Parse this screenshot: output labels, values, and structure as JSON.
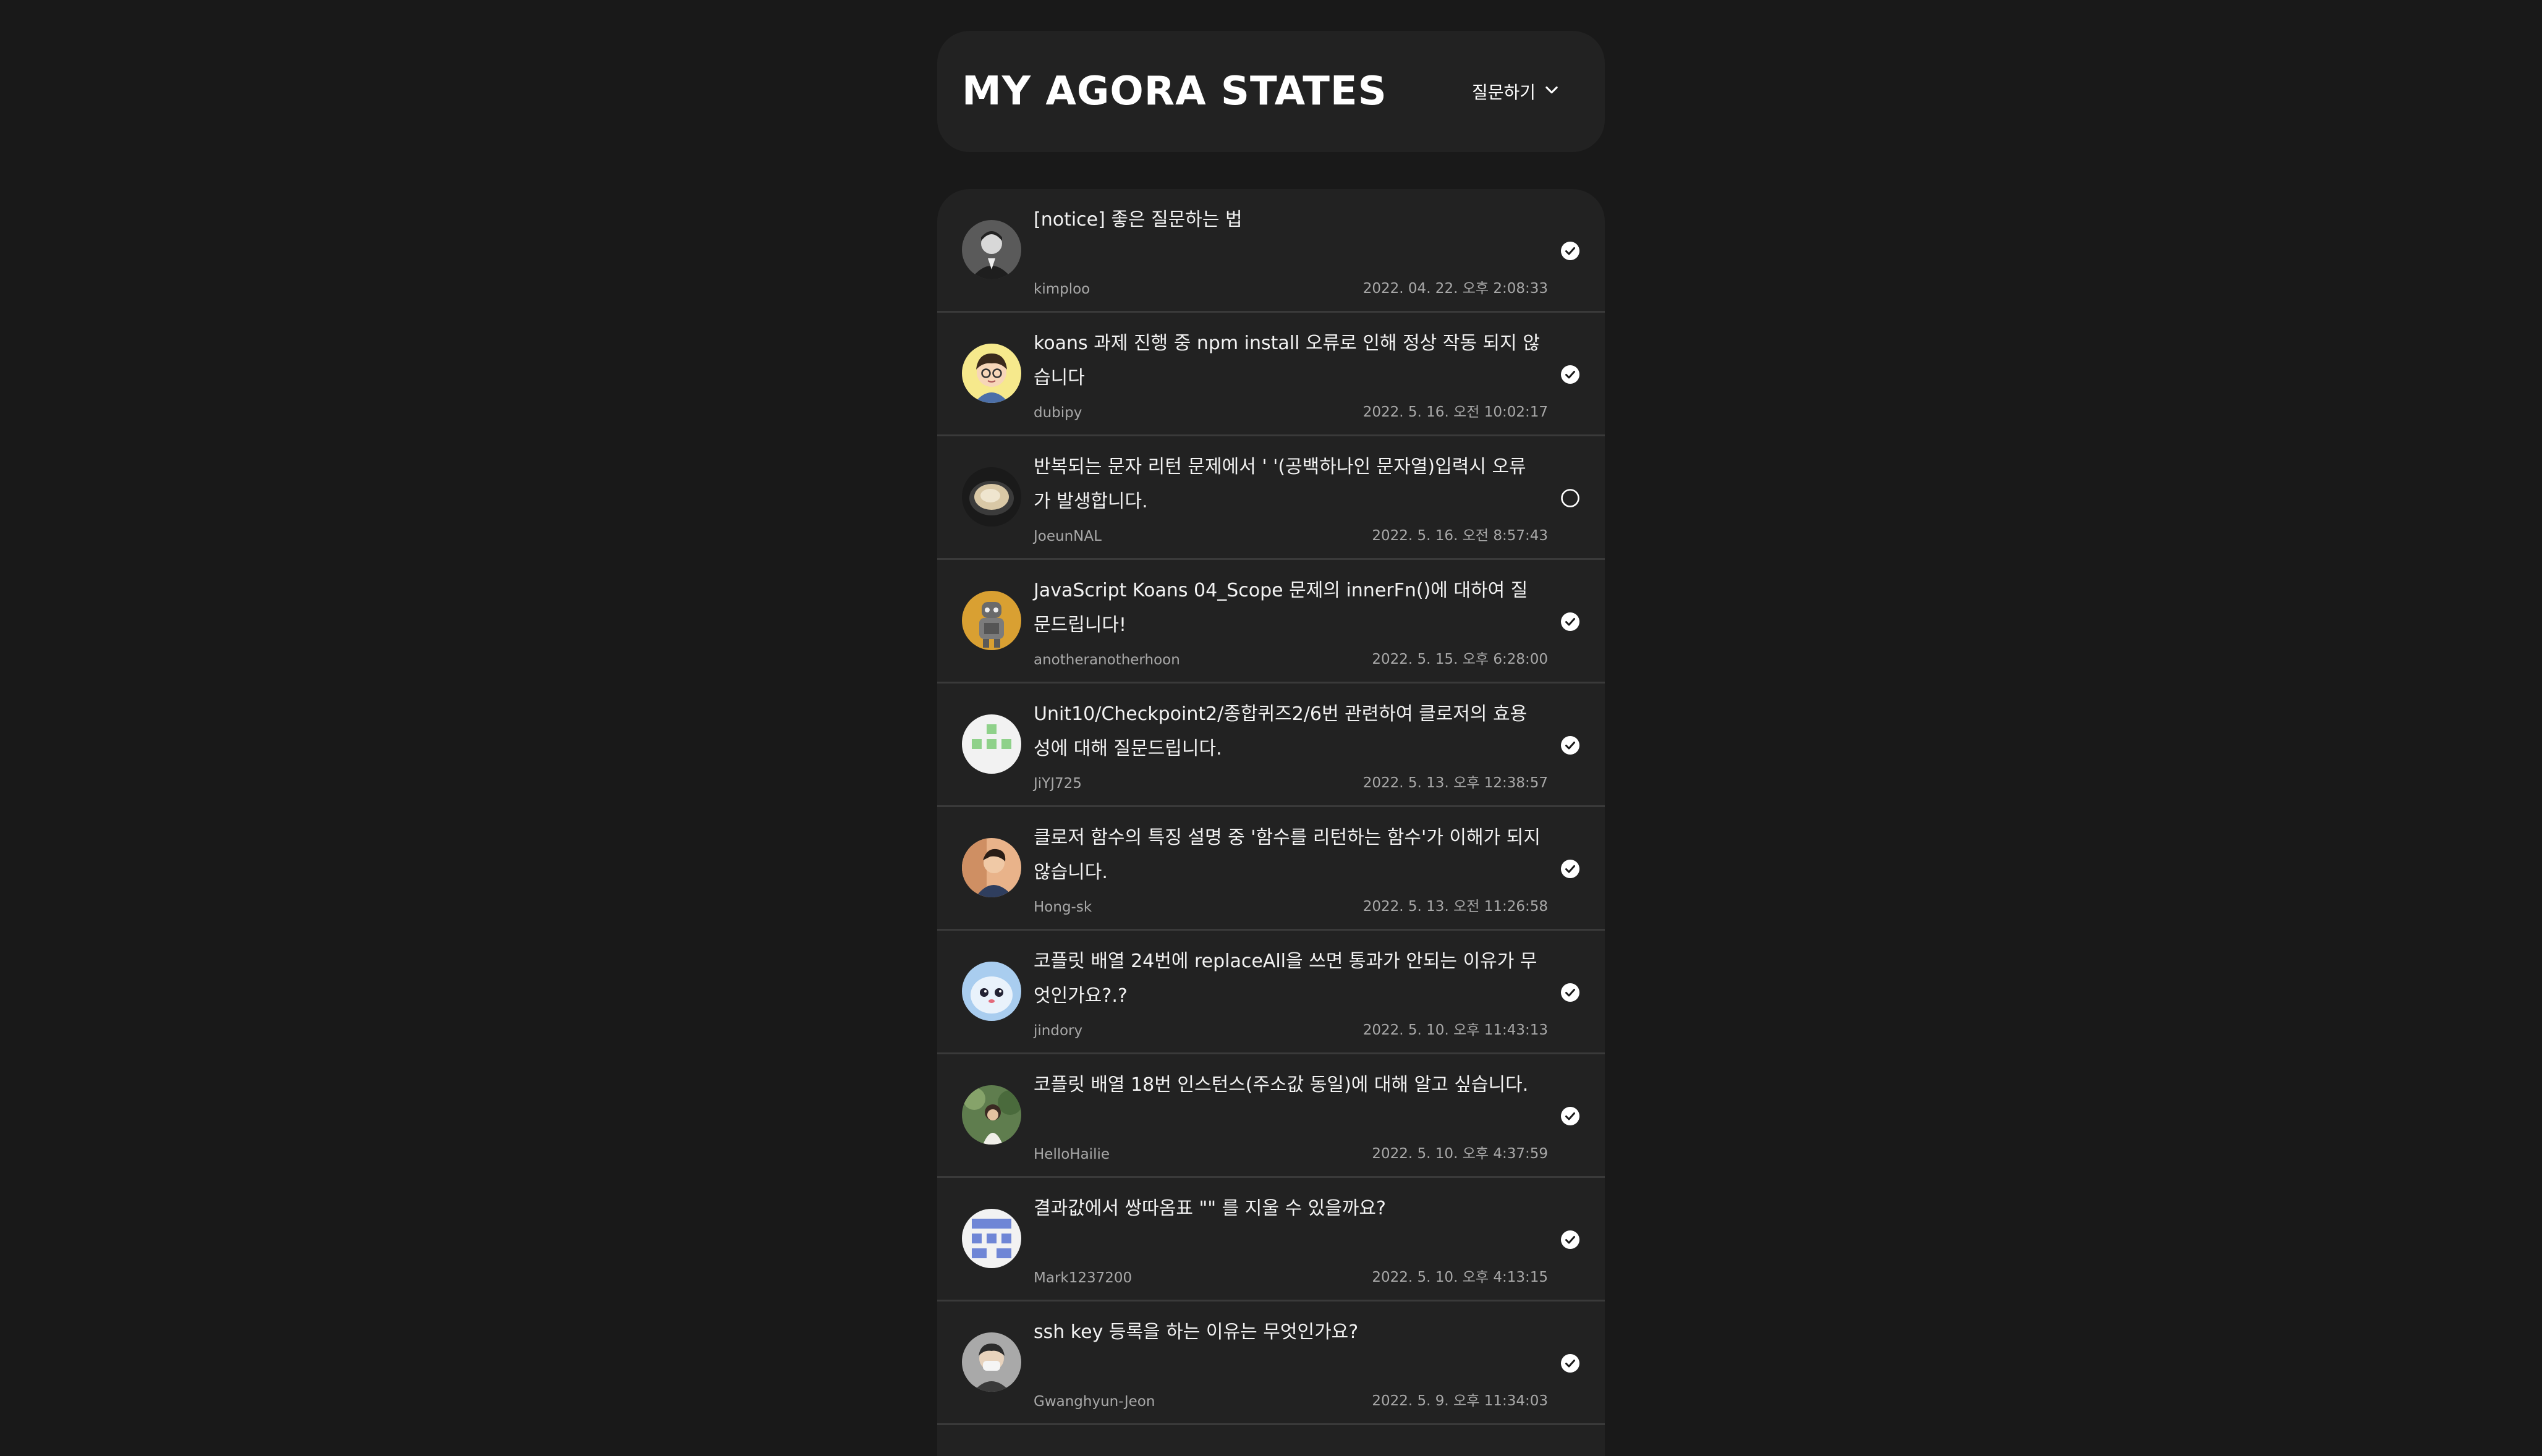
{
  "header": {
    "title": "MY AGORA STATES",
    "ask_label": "질문하기"
  },
  "colors": {
    "background": "#191919",
    "panel": "#222222",
    "divider": "#3a3a3a",
    "text_primary": "#f2f2f2",
    "text_secondary": "#a8a8a8"
  },
  "discussions": [
    {
      "title": "[notice] 좋은 질문하는 법",
      "author": "kimploo",
      "date": "2022. 04. 22. 오후 2:08:33",
      "answered": true,
      "avatar": "photo-grayscale-person"
    },
    {
      "title": "koans 과제 진행 중 npm install 오류로 인해 정상 작동 되지 않습니다",
      "author": "dubipy",
      "date": "2022. 5. 16. 오전 10:02:17",
      "answered": true,
      "avatar": "cartoon-boy"
    },
    {
      "title": "반복되는 문자 리턴 문제에서 ' '(공백하나인 문자열)입력시 오류가 발생합니다.",
      "author": "JoeunNAL",
      "date": "2022. 5. 16. 오전 8:57:43",
      "answered": false,
      "avatar": "food-bowl"
    },
    {
      "title": "JavaScript Koans 04_Scope 문제의 innerFn()에 대하여 질문드립니다!",
      "author": "anotheranotherhoon",
      "date": "2022. 5. 15. 오후 6:28:00",
      "answered": true,
      "avatar": "figure-on-orange"
    },
    {
      "title": "Unit10/Checkpoint2/종합퀴즈2/6번 관련하여 클로저의 효용성에 대해 질문드립니다.",
      "author": "JiYJ725",
      "date": "2022. 5. 13. 오후 12:38:57",
      "answered": true,
      "avatar": "green-identicon"
    },
    {
      "title": "클로저 함수의 특징 설명 중 '함수를 리턴하는 함수'가 이해가 되지 않습니다.",
      "author": "Hong-sk",
      "date": "2022. 5. 13. 오전 11:26:58",
      "answered": true,
      "avatar": "photo-person-warm"
    },
    {
      "title": "코플릿 배열 24번에 replaceAll을 쓰면 통과가 안되는 이유가 무엇인가요?.?",
      "author": "jindory",
      "date": "2022. 5. 10. 오후 11:43:13",
      "answered": true,
      "avatar": "blue-character"
    },
    {
      "title": "코플릿 배열 18번 인스턴스(주소값 동일)에 대해 알고 싶습니다.",
      "author": "HelloHailie",
      "date": "2022. 5. 10. 오후 4:37:59",
      "answered": true,
      "avatar": "photo-person-green"
    },
    {
      "title": "결과값에서 쌍따옴표 \"\" 를 지울 수 있을까요?",
      "author": "Mark1237200",
      "date": "2022. 5. 10. 오후 4:13:15",
      "answered": true,
      "avatar": "blue-identicon"
    },
    {
      "title": "ssh key 등록을 하는 이유는 무엇인가요?",
      "author": "Gwanghyun-Jeon",
      "date": "2022. 5. 9. 오후 11:34:03",
      "answered": true,
      "avatar": "photo-person-mask"
    }
  ]
}
